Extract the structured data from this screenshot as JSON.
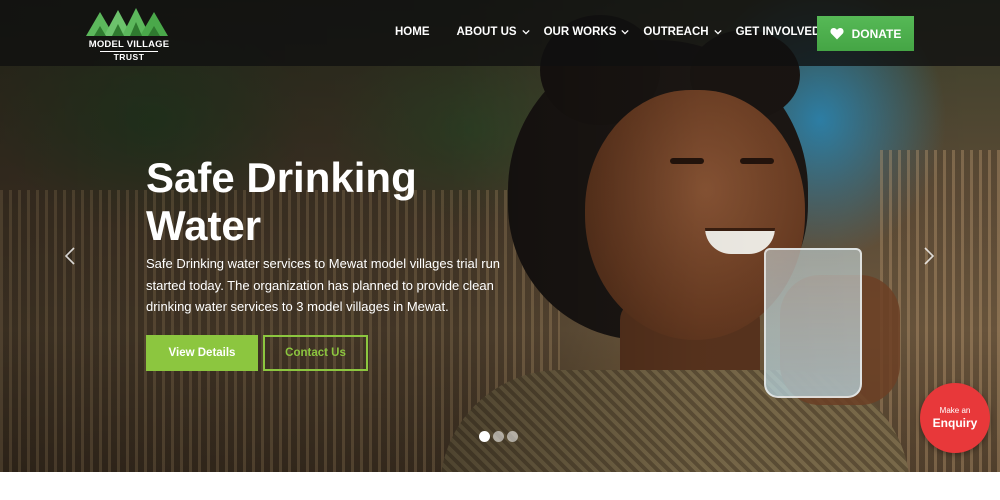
{
  "logo": {
    "line1": "MODEL VILLAGE",
    "line2": "TRUST",
    "mark_color": "#5cb85c"
  },
  "nav": {
    "items": [
      {
        "label": "HOME",
        "has_dropdown": false
      },
      {
        "label": "ABOUT US",
        "has_dropdown": true
      },
      {
        "label": "OUR WORKS",
        "has_dropdown": true
      },
      {
        "label": "OUTREACH",
        "has_dropdown": true
      },
      {
        "label": "GET INVOLVED",
        "has_dropdown": true
      }
    ],
    "chevron_icon": "chevron-down-icon"
  },
  "donate": {
    "label": "DONATE",
    "icon": "heart-icon",
    "color": "#4cae4c"
  },
  "hero": {
    "title_line1": "Safe Drinking",
    "title_line2": "Water",
    "description": "Safe Drinking water services to Mewat model villages trial run started today. The organization has planned to provide clean drinking water services to 3 model villages in Mewat.",
    "primary_button": "View Details",
    "secondary_button": "Contact Us",
    "accent_color": "#8cc63f",
    "prev_icon": "chevron-left-icon",
    "next_icon": "chevron-right-icon",
    "slides_total": 3,
    "active_slide": 1
  },
  "enquiry": {
    "line1": "Make an",
    "line2": "Enquiry",
    "color": "#e8383a"
  }
}
